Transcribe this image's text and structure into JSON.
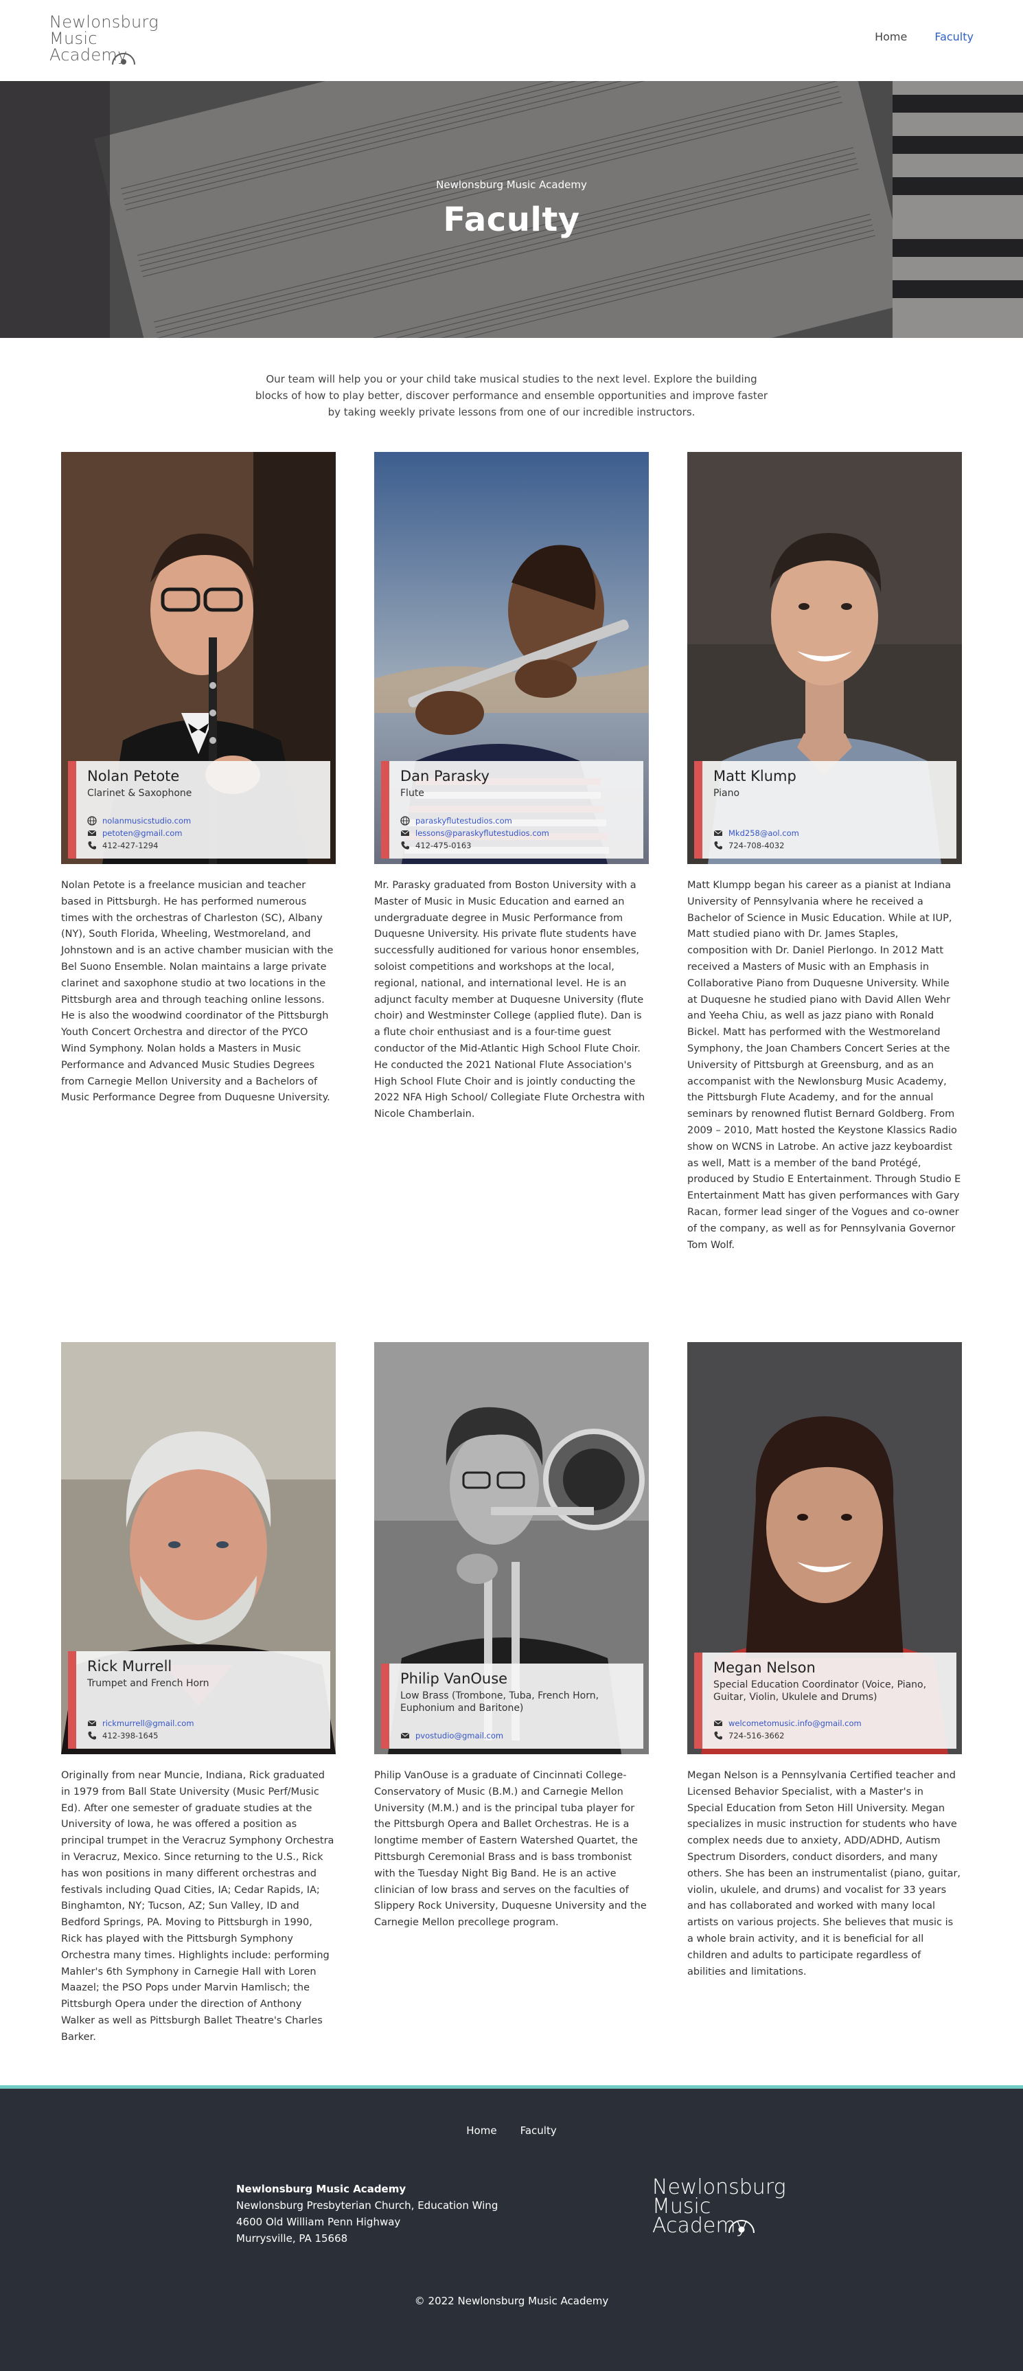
{
  "header": {
    "logo_lines": [
      "Newlonsburg",
      "Music",
      "Academy"
    ],
    "nav": [
      {
        "label": "Home",
        "active": false
      },
      {
        "label": "Faculty",
        "active": true
      }
    ]
  },
  "hero": {
    "subtitle": "Newlonsburg Music Academy",
    "title": "Faculty"
  },
  "intro": "Our team will help you or your child take musical studies to the next level. Explore the building blocks of how to play better, discover performance and ensemble opportunities and improve faster by taking weekly private lessons from one of our incredible instructors.",
  "faculty": [
    {
      "name": "Nolan Petote",
      "role": "Clarinet & Saxophone",
      "website": "nolanmusicstudio.com",
      "email": "petoten@gmail.com",
      "phone": "412-427-1294",
      "bio": "Nolan Petote is a freelance musician and teacher based in Pittsburgh. He has performed numerous times with the orchestras of Charleston (SC), Albany (NY), South Florida, Wheeling, Westmoreland, and Johnstown and is an active chamber musician with the Bel Suono Ensemble. Nolan maintains a large private clarinet and saxophone studio at two locations in the Pittsburgh area and through teaching online lessons. He is also the woodwind coordinator of the Pittsburgh Youth Concert Orchestra and director of the PYCO Wind Symphony. Nolan holds a Masters in Music Performance and Advanced Music Studies Degrees from Carnegie Mellon University and a Bachelors of Music Performance Degree from Duquesne University."
    },
    {
      "name": "Dan Parasky",
      "role": "Flute",
      "website": "paraskyflutestudios.com",
      "email": "lessons@paraskyflutestudios.com",
      "phone": "412-475-0163",
      "bio": "Mr. Parasky graduated from Boston University with a Master of Music in Music Education and earned an undergraduate degree in Music Performance from Duquesne University. His private flute students have successfully auditioned for various honor ensembles, soloist competitions and workshops at the local, regional, national, and international level. He is an adjunct faculty member at Duquesne University (flute choir) and Westminster College (applied flute). Dan is a flute choir enthusiast and is a four-time guest conductor of the Mid-Atlantic High School Flute Choir. He conducted the 2021 National Flute Association's High School Flute Choir and is jointly conducting the 2022 NFA High School/ Collegiate Flute Orchestra with Nicole Chamberlain."
    },
    {
      "name": "Matt Klump",
      "role": "Piano",
      "website": "",
      "email": "Mkd258@aol.com",
      "phone": "724-708-4032",
      "bio": "Matt Klumpp began his career as a pianist at Indiana University of Pennsylvania where he received a Bachelor of Science in Music Education. While at IUP, Matt studied piano with Dr. James Staples, composition with Dr. Daniel Pierlongo. In 2012 Matt received a Masters of Music with an Emphasis in Collaborative Piano from Duquesne University. While at Duquesne he studied piano with David Allen Wehr and Yeeha Chiu, as well as jazz piano with Ronald Bickel. Matt has performed with the Westmoreland Symphony, the Joan Chambers Concert Series at the University of Pittsburgh at Greensburg, and as an accompanist with the Newlonsburg Music Academy, the Pittsburgh Flute Academy, and for the annual seminars by renowned flutist Bernard Goldberg. From 2009 – 2010, Matt hosted the Keystone Klassics Radio show on WCNS in Latrobe. An active jazz keyboardist as well, Matt is a member of the band Protégé, produced by Studio E Entertainment. Through Studio E Entertainment Matt has given performances with Gary Racan, former lead singer of the Vogues and co-owner of the company, as well as for Pennsylvania Governor Tom Wolf."
    },
    {
      "name": "Rick Murrell",
      "role": "Trumpet and French Horn",
      "website": "",
      "email": "rickmurrell@gmail.com",
      "phone": "412-398-1645",
      "bio": "Originally from near Muncie, Indiana, Rick graduated in 1979 from Ball State University (Music Perf/Music Ed). After one semester of graduate studies at the University of Iowa, he was offered a position as principal trumpet in the Veracruz Symphony Orchestra in Veracruz, Mexico. Since returning to the U.S., Rick has won positions in many different orchestras and festivals including Quad Cities, IA; Cedar Rapids, IA; Binghamton, NY; Tucson, AZ; Sun Valley, ID and Bedford Springs, PA. Moving to Pittsburgh in 1990, Rick has played with the Pittsburgh Symphony Orchestra many times. Highlights include: performing Mahler's 6th Symphony in Carnegie Hall with Loren Maazel; the PSO Pops under Marvin Hamlisch; the Pittsburgh Opera under the direction of Anthony Walker as well as Pittsburgh Ballet Theatre's Charles Barker."
    },
    {
      "name": "Philip VanOuse",
      "role": "Low Brass (Trombone, Tuba, French Horn, Euphonium and Baritone)",
      "website": "",
      "email": "pvostudio@gmail.com",
      "phone": "",
      "bio": "Philip VanOuse is a graduate of Cincinnati College- Conservatory of Music (B.M.) and Carnegie Mellon University (M.M.) and is the principal tuba player for the Pittsburgh Opera and Ballet Orchestras. He is a longtime member of Eastern Watershed Quartet, the Pittsburgh Ceremonial Brass and is bass trombonist with the Tuesday Night Big Band. He is an active clinician of low brass and serves on the faculties of Slippery Rock University, Duquesne University and the Carnegie Mellon precollege program."
    },
    {
      "name": "Megan Nelson",
      "role": "Special Education Coordinator (Voice, Piano, Guitar, Violin, Ukulele and Drums)",
      "website": "",
      "email": "welcometomusic.info@gmail.com",
      "phone": "724-516-3662",
      "bio": "Megan Nelson is a Pennsylvania Certified teacher and Licensed Behavior Specialist, with a Master's in Special Education from Seton Hill University. Megan specializes in music instruction for students who have complex needs due to anxiety, ADD/ADHD, Autism Spectrum Disorders, conduct disorders, and many others. She has been an instrumentalist (piano, guitar, violin, ukulele, and drums) and vocalist for 33 years and has collaborated and worked with many local artists on various projects. She believes that music is a whole brain activity, and it is beneficial for all children and adults to participate regardless of abilities and limitations."
    }
  ],
  "footer": {
    "nav": [
      "Home",
      "Faculty"
    ],
    "org": "Newlonsburg Music Academy",
    "address": [
      "Newlonsburg Presbyterian Church, Education Wing",
      "4600 Old William Penn Highway",
      "Murrysville, PA 15668"
    ],
    "logo_lines": [
      "Newlonsburg",
      "Music",
      "Academy"
    ],
    "copyright": "© 2022 Newlonsburg Music Academy"
  },
  "colors": {
    "accent_bar": "#d95353",
    "link": "#3555c8",
    "nav_active": "#2e61c6",
    "footer_bg": "#2b3038",
    "footer_border": "#6fcbc4"
  }
}
